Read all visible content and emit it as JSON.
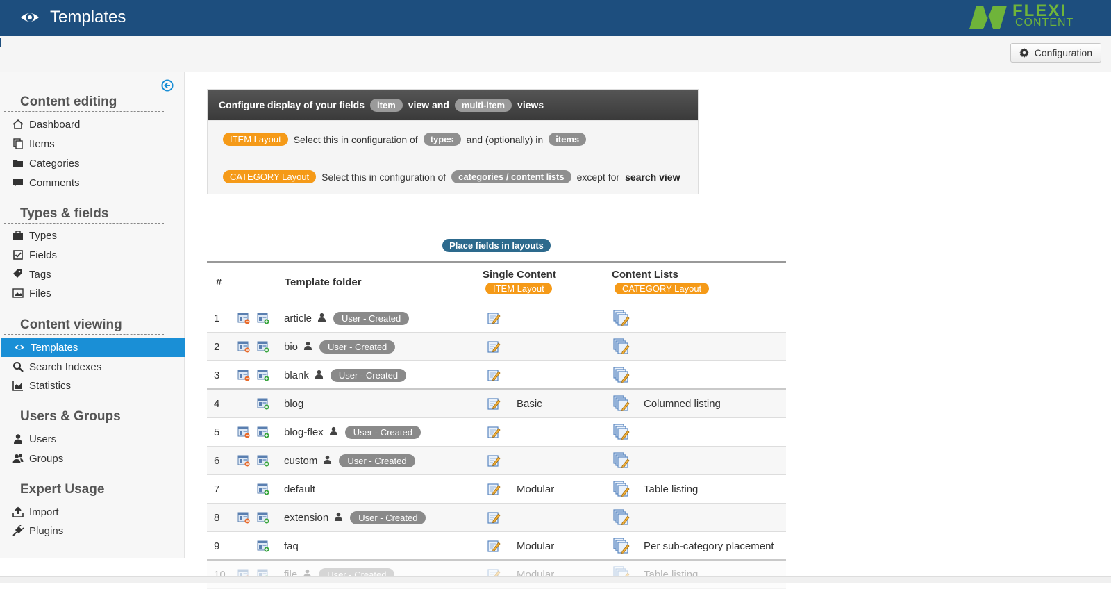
{
  "header": {
    "title": "Templates",
    "logo_top": "FLEXI",
    "logo_bottom": "CONTENT"
  },
  "toolbar": {
    "config_label": "Configuration"
  },
  "sidebar": {
    "sections": [
      {
        "title": "Content editing",
        "items": [
          {
            "label": "Dashboard",
            "icon": "home-icon"
          },
          {
            "label": "Items",
            "icon": "copy-icon"
          },
          {
            "label": "Categories",
            "icon": "folder-icon"
          },
          {
            "label": "Comments",
            "icon": "comment-icon"
          }
        ]
      },
      {
        "title": "Types & fields",
        "items": [
          {
            "label": "Types",
            "icon": "briefcase-icon"
          },
          {
            "label": "Fields",
            "icon": "checkbox-icon"
          },
          {
            "label": "Tags",
            "icon": "tags-icon"
          },
          {
            "label": "Files",
            "icon": "image-icon"
          }
        ]
      },
      {
        "title": "Content viewing",
        "items": [
          {
            "label": "Templates",
            "icon": "eye-icon",
            "active": true
          },
          {
            "label": "Search Indexes",
            "icon": "search-icon"
          },
          {
            "label": "Statistics",
            "icon": "chart-icon"
          }
        ]
      },
      {
        "title": "Users & Groups",
        "items": [
          {
            "label": "Users",
            "icon": "user-icon"
          },
          {
            "label": "Groups",
            "icon": "users-icon"
          }
        ]
      },
      {
        "title": "Expert Usage",
        "items": [
          {
            "label": "Import",
            "icon": "upload-icon"
          },
          {
            "label": "Plugins",
            "icon": "plug-icon"
          }
        ]
      }
    ]
  },
  "info": {
    "head_text1": "Configure display of your fields",
    "head_pill1": "item",
    "head_text2": "view and",
    "head_pill2": "multi-item",
    "head_text3": "views",
    "row1": {
      "pill": "ITEM Layout",
      "text1": "Select this in configuration of",
      "pill2": "types",
      "text2": "and (optionally) in",
      "pill3": "items"
    },
    "row2": {
      "pill": "CATEGORY Layout",
      "text1": "Select this in configuration of",
      "pill2": "categories / content lists",
      "text2": "except for",
      "bold": "search view"
    }
  },
  "table": {
    "place_label": "Place fields in layouts",
    "headers": {
      "num": "#",
      "folder": "Template folder",
      "single": "Single Content",
      "single_badge": "ITEM Layout",
      "lists": "Content Lists",
      "lists_badge": "CATEGORY Layout"
    },
    "user_badge": "User - Created",
    "rows": [
      {
        "num": "1",
        "folder": "article",
        "user": true,
        "single": "",
        "lists": ""
      },
      {
        "num": "2",
        "folder": "bio",
        "user": true,
        "single": "",
        "lists": ""
      },
      {
        "num": "3",
        "folder": "blank",
        "user": true,
        "single": "",
        "lists": ""
      },
      {
        "num": "4",
        "folder": "blog",
        "user": false,
        "single": "Basic",
        "lists": "Columned listing"
      },
      {
        "num": "5",
        "folder": "blog-flex",
        "user": true,
        "single": "",
        "lists": ""
      },
      {
        "num": "6",
        "folder": "custom",
        "user": true,
        "single": "",
        "lists": ""
      },
      {
        "num": "7",
        "folder": "default",
        "user": false,
        "single": "Modular",
        "lists": "Table listing"
      },
      {
        "num": "8",
        "folder": "extension",
        "user": true,
        "single": "",
        "lists": ""
      },
      {
        "num": "9",
        "folder": "faq",
        "user": false,
        "single": "Modular",
        "lists": "Per sub-category placement"
      },
      {
        "num": "10",
        "folder": "file",
        "user": true,
        "single": "Modular",
        "lists": "Table listing"
      }
    ]
  }
}
